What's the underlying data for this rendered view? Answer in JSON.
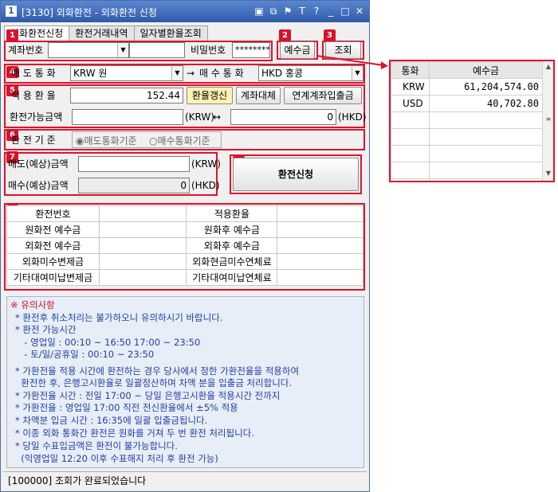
{
  "window": {
    "id_icon": "1",
    "title": "[3130] 외화환전 - 외화환전 신청",
    "buttons": [
      "layout-icon",
      "copy-icon",
      "pin-icon",
      "text-icon",
      "help-icon",
      "minimize-icon",
      "maximize-icon",
      "close-icon"
    ],
    "button_glyphs": [
      "▣",
      "⧉",
      "⚑",
      "T",
      "?",
      "_",
      "□",
      "✕"
    ]
  },
  "tabs": [
    {
      "label": "외화환전신청",
      "active": true
    },
    {
      "label": "환전거래내역",
      "active": false
    },
    {
      "label": "일자별환율조회",
      "active": false
    }
  ],
  "badges": [
    "1",
    "2",
    "3",
    "4",
    "5",
    "6",
    "7",
    "8",
    "9"
  ],
  "account": {
    "label": "계좌번호",
    "account_value": "",
    "extra_value": "",
    "password_label": "비밀번호",
    "password_value": "********",
    "deposit_button": "예수금",
    "inquiry_button": "조회"
  },
  "currency": {
    "sell_label": "매 도 통 화",
    "sell_value": "KRW 원",
    "arrow": "→",
    "buy_label": "매 수 통 화",
    "buy_value": "HKD 홍콩"
  },
  "rate": {
    "label": "적 용 환 율",
    "value": "152.44",
    "update_button": "환율갱신",
    "account_substitute_button": "계좌대체",
    "linked_account_button": "연계계좌입출금",
    "available_label": "환전가능금액",
    "available_krw": "",
    "krw_unit": "(KRW)",
    "swap": "↔",
    "available_hkd": "0",
    "hkd_unit": "(HKD)"
  },
  "basis": {
    "label": "환 전 기 준",
    "option_sell": "매도통화기준",
    "option_buy": "매수통화기준",
    "selected": "sell"
  },
  "amounts": {
    "sell_label": "매도(예상)금액",
    "sell_value": "",
    "sell_unit": "(KRW)",
    "buy_label": "매수(예상)금액",
    "buy_value": "0",
    "buy_unit": "(HKD)"
  },
  "submit_button": "환전신청",
  "summary": {
    "rows": [
      [
        "환전번호",
        "",
        "적용환율",
        ""
      ],
      [
        "원화전 예수금",
        "",
        "원화후 예수금",
        ""
      ],
      [
        "외화전 예수금",
        "",
        "외화후 예수금",
        ""
      ],
      [
        "외화미수변제금",
        "",
        "외화현금미수연체료",
        ""
      ],
      [
        "기타대여미납변제금",
        "",
        "기타대여미납연체료",
        ""
      ]
    ]
  },
  "notice": {
    "title": "※ 유의사항",
    "lines": [
      "* 환전후 취소처리는 불가하오니 유의하시기 바랍니다.",
      "* 환전 가능시간",
      "  - 영업일 : 00:10 ~ 16:50 17:00 ~ 23:50",
      "  - 토/일/공휴일 : 00:10 ~ 23:50",
      "* 가환전율 적용 시간에 환전하는 경우 당사에서 정한 가환전율을 적용하여",
      "  환전한 후, 은행고시환율로 일괄정산하며 차액 분을 입출금 처리합니다.",
      "* 가환전율 시간 : 전일 17:00 ~ 당일 은행고시환율 적용시간 전까지",
      "* 가환전율 : 영업일 17:00 직전 전신환율에서 ±5% 적용",
      "* 차액분 입금 시간 : 16:35에 일괄 입출금됩니다.",
      "* 이종 외화 통화간 환전은 원화를 거쳐 두 번 환전 처리됩니다.",
      "* 당일 수표입금액은 환전이 불가능합니다.",
      "  (익영업일 12:20 이후 수표해지 처리 후 환전 가능)"
    ]
  },
  "status": "[100000] 조회가 완료되었습니다",
  "deposit_popup": {
    "headers": [
      "통화",
      "예수금"
    ],
    "rows": [
      [
        "KRW",
        "61,204,574.00"
      ],
      [
        "USD",
        "40,702.80"
      ]
    ]
  },
  "colors": {
    "highlight_red": "#e0122c",
    "title_bar": "#2f5aa8",
    "notice_text": "#1f3ea8"
  }
}
